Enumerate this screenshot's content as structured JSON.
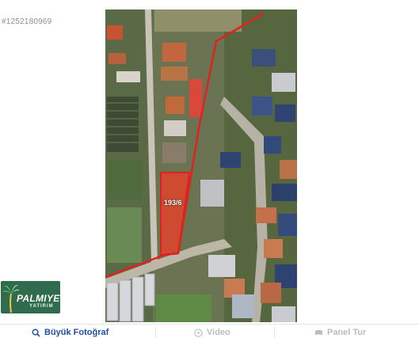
{
  "listing": {
    "id": "#1252180969"
  },
  "photo": {
    "parcel_label": "193/6",
    "colors": {
      "parcel_outline": "#e0221f",
      "parcel_fill": "#d9462e"
    }
  },
  "watermark": {
    "brand": "PALMIYE",
    "sub": "YATIRIM"
  },
  "tabs": [
    {
      "label": "Büyük Fotoğraf",
      "icon": "search-icon",
      "active": true
    },
    {
      "label": "Video",
      "icon": "play-icon",
      "active": false
    },
    {
      "label": "Panel Tur",
      "icon": "panorama-icon",
      "active": false
    }
  ],
  "colors": {
    "accent": "#1f4fa3",
    "muted": "#b9bec4",
    "id_text": "#8a8f94"
  }
}
